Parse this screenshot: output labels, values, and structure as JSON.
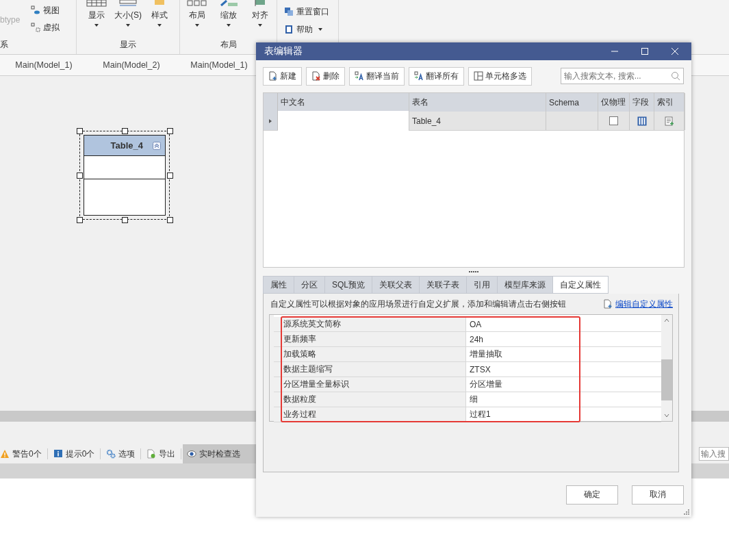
{
  "ribbon": {
    "groups": [
      {
        "label": "系",
        "items": [
          {
            "label": "btype",
            "kind": "small",
            "disabled": true,
            "dropdown": false
          },
          {
            "label": "视图",
            "kind": "small",
            "disabled": false,
            "dropdown": false
          },
          {
            "label": "虚拟",
            "kind": "small",
            "disabled": false,
            "dropdown": false
          }
        ]
      },
      {
        "label": "显示",
        "items": [
          {
            "label": "显示",
            "kind": "large",
            "disabled": false,
            "dropdown": true
          },
          {
            "label": "大小(S)",
            "kind": "large",
            "disabled": false,
            "dropdown": true
          },
          {
            "label": "样式",
            "kind": "large",
            "disabled": false,
            "dropdown": true
          }
        ]
      },
      {
        "label": "布局",
        "items": [
          {
            "label": "布局",
            "kind": "large",
            "disabled": false,
            "dropdown": true
          },
          {
            "label": "缩放",
            "kind": "large",
            "disabled": false,
            "dropdown": true
          },
          {
            "label": "对齐",
            "kind": "large",
            "disabled": false,
            "dropdown": true
          }
        ]
      },
      {
        "items": [
          {
            "label": "重置窗口",
            "kind": "small",
            "disabled": false,
            "dropdown": false
          },
          {
            "label": "帮助",
            "kind": "small",
            "disabled": false,
            "dropdown": true
          }
        ]
      }
    ]
  },
  "document_tabs": [
    {
      "label": "Main(Model_1)"
    },
    {
      "label": "Main(Model_2)"
    },
    {
      "label": "Main(Model_1)"
    }
  ],
  "canvas": {
    "nodes": [
      {
        "title": "Table_4",
        "selected": true
      }
    ]
  },
  "check_bar": {
    "items": [
      {
        "label": "警告0个",
        "selected": false
      },
      {
        "label": "提示0个",
        "selected": false
      },
      {
        "label": "选项",
        "selected": false
      },
      {
        "label": "导出",
        "selected": false
      },
      {
        "label": "实时检查选",
        "selected": true
      }
    ],
    "search": {
      "placeholder": "输入搜"
    }
  },
  "dialog": {
    "title": "表编辑器",
    "toolbar": [
      {
        "label": "新建"
      },
      {
        "label": "删除"
      },
      {
        "label": "翻译当前"
      },
      {
        "label": "翻译所有"
      },
      {
        "label": "单元格多选"
      }
    ],
    "search": {
      "placeholder": "输入搜索文本, 搜索..."
    },
    "table": {
      "columns": [
        "中文名",
        "表名",
        "Schema",
        "仅物理",
        "字段",
        "索引"
      ],
      "rows": [
        {
          "current": true,
          "table_name": "Table_4",
          "physical_only": false
        }
      ]
    },
    "tabs": [
      {
        "label": "属性",
        "selected": false
      },
      {
        "label": "分区",
        "selected": false
      },
      {
        "label": "SQL预览",
        "selected": false
      },
      {
        "label": "关联父表",
        "selected": false
      },
      {
        "label": "关联子表",
        "selected": false
      },
      {
        "label": "引用",
        "selected": false
      },
      {
        "label": "模型库来源",
        "selected": false
      },
      {
        "label": "自定义属性",
        "selected": true
      }
    ],
    "description": "自定义属性可以根据对象的应用场景进行自定义扩展，添加和编辑请点击右侧按钮",
    "edit_link": "编辑自定义属性",
    "properties": {
      "highlighted": true,
      "rows": [
        {
          "name": "源系统英文简称",
          "value": "OA"
        },
        {
          "name": "更新频率",
          "value": "24h"
        },
        {
          "name": "加载策略",
          "value": "增量抽取"
        },
        {
          "name": "数据主题缩写",
          "value": "ZTSX"
        },
        {
          "name": "分区增量全量标识",
          "value": "分区增量"
        },
        {
          "name": "数据粒度",
          "value": "细"
        },
        {
          "name": "业务过程",
          "value": "过程1"
        }
      ]
    },
    "buttons": [
      "确定",
      "取消"
    ]
  }
}
